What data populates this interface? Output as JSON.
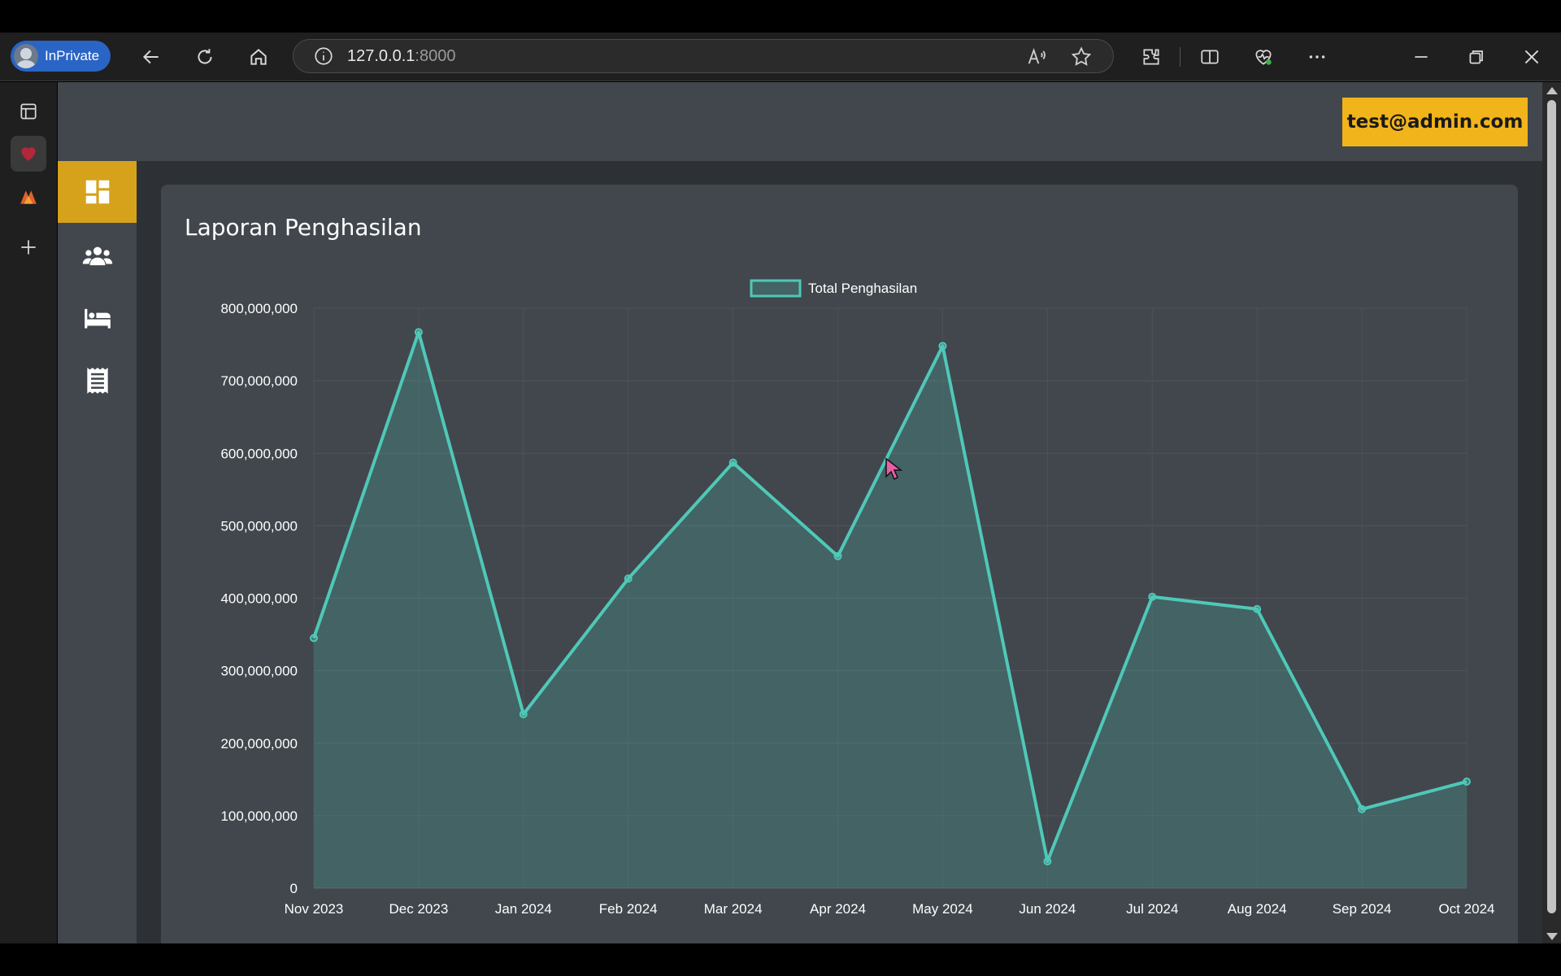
{
  "browser": {
    "profile_label": "InPrivate",
    "url_host": "127.0.0.1",
    "url_port": ":8000"
  },
  "app": {
    "user_email": "test@admin.com",
    "nav_items": [
      {
        "name": "dashboard",
        "icon": "dashboard-icon",
        "active": true
      },
      {
        "name": "users",
        "icon": "users-icon",
        "active": false
      },
      {
        "name": "rooms",
        "icon": "bed-icon",
        "active": false
      },
      {
        "name": "reports",
        "icon": "receipt-icon",
        "active": false
      }
    ],
    "card_title": "Laporan Penghasilan",
    "colors": {
      "accent": "#f2b41b",
      "line": "#4fc8b8",
      "panel": "#41474d"
    }
  },
  "chart_data": {
    "type": "area",
    "title": "",
    "xlabel": "",
    "ylabel": "",
    "categories": [
      "Nov 2023",
      "Dec 2023",
      "Jan 2024",
      "Feb 2024",
      "Mar 2024",
      "Apr 2024",
      "May 2024",
      "Jun 2024",
      "Jul 2024",
      "Aug 2024",
      "Sep 2024",
      "Oct 2024"
    ],
    "series": [
      {
        "name": "Total Penghasilan",
        "values": [
          345000000,
          767000000,
          240000000,
          427000000,
          587000000,
          458000000,
          748000000,
          37000000,
          402000000,
          385000000,
          109000000,
          147000000
        ]
      }
    ],
    "ylim": [
      0,
      800000000
    ],
    "y_ticks": [
      "0",
      "100,000,000",
      "200,000,000",
      "300,000,000",
      "400,000,000",
      "500,000,000",
      "600,000,000",
      "700,000,000",
      "800,000,000"
    ],
    "legend_position": "top-center",
    "grid": true
  }
}
